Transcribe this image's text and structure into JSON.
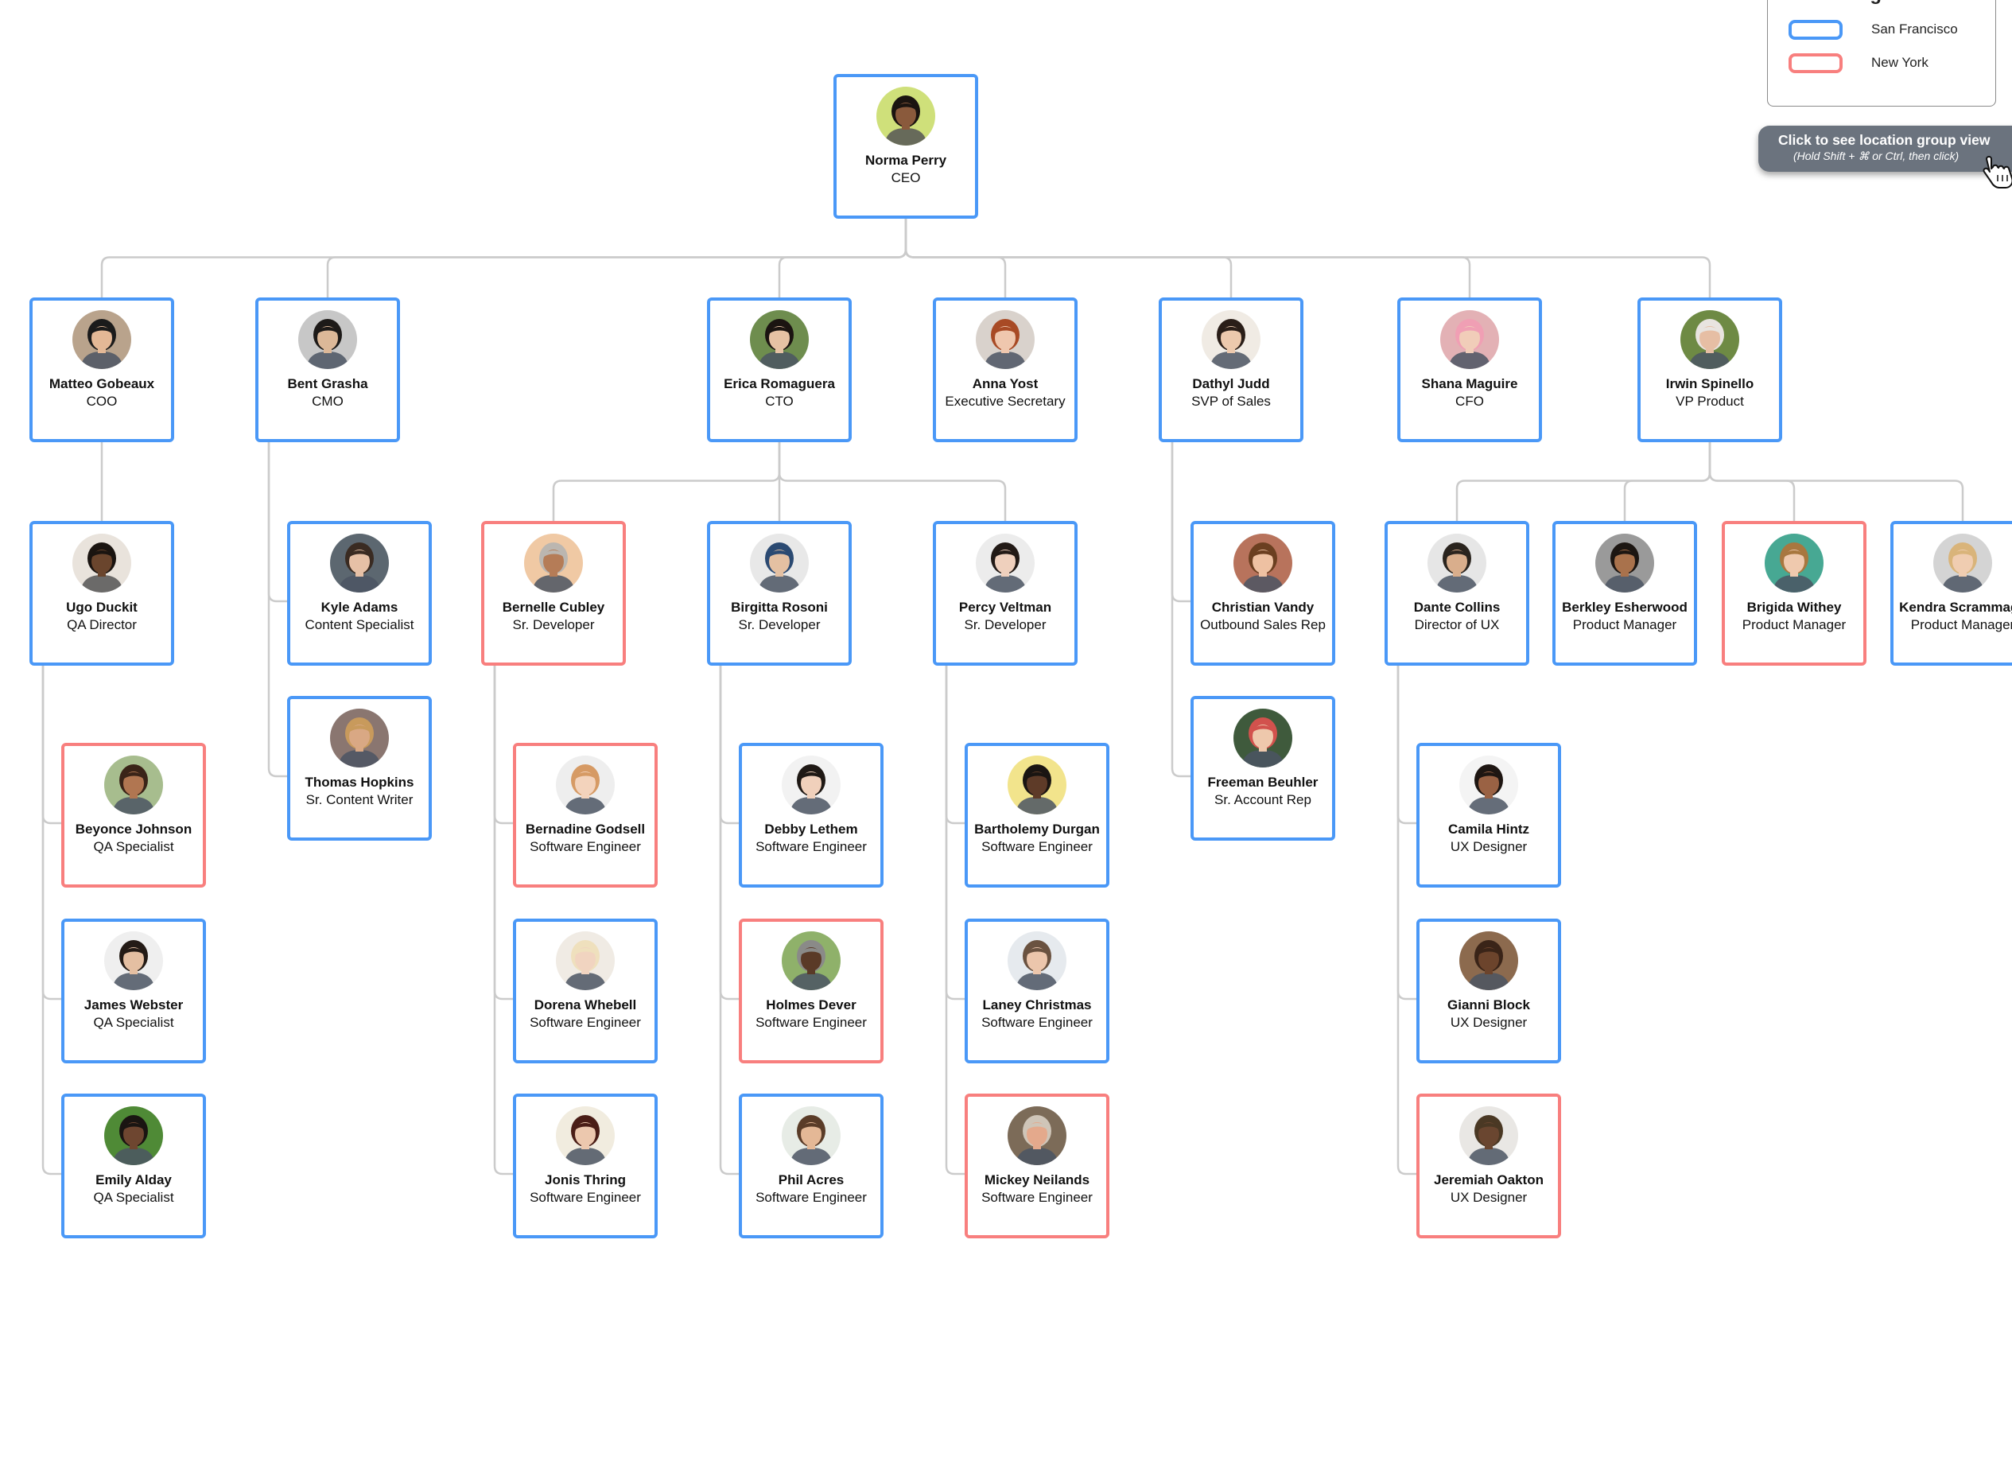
{
  "legend": {
    "title": "Legend",
    "items": [
      {
        "label": "San Francisco",
        "color": "#4a98f7"
      },
      {
        "label": "New York",
        "color": "#f87f7e"
      }
    ]
  },
  "group_view_button": {
    "label": "Click to see location group view",
    "hint": "(Hold Shift + ⌘ or Ctrl, then click)"
  },
  "locations": {
    "sf": {
      "name": "San Francisco",
      "color": "#4a98f7"
    },
    "ny": {
      "name": "New York",
      "color": "#f87f7e"
    }
  },
  "people": [
    {
      "id": "norma",
      "name": "Norma Perry",
      "title": "CEO",
      "loc": "sf",
      "parent": null,
      "skin": "#8a5a3c",
      "hair": "#1a1410",
      "bg": "#cfe07a"
    },
    {
      "id": "matteo",
      "name": "Matteo Gobeaux",
      "title": "COO",
      "loc": "sf",
      "parent": "norma",
      "skin": "#e3b896",
      "hair": "#1b1b1b",
      "bg": "#b9a38c"
    },
    {
      "id": "bent",
      "name": "Bent Grasha",
      "title": "CMO",
      "loc": "sf",
      "parent": "norma",
      "skin": "#dcb898",
      "hair": "#1d1a18",
      "bg": "#c7c7c7"
    },
    {
      "id": "erica",
      "name": "Erica Romaguera",
      "title": "CTO",
      "loc": "sf",
      "parent": "norma",
      "skin": "#e6c2a4",
      "hair": "#1b1411",
      "bg": "#6e8d4e"
    },
    {
      "id": "anna",
      "name": "Anna Yost",
      "title": "Executive Secretary",
      "loc": "sf",
      "parent": "norma",
      "skin": "#efc7ae",
      "hair": "#a84a25",
      "bg": "#d9d2cc"
    },
    {
      "id": "dathyl",
      "name": "Dathyl Judd",
      "title": "SVP of Sales",
      "loc": "sf",
      "parent": "norma",
      "skin": "#ecc9ad",
      "hair": "#2a1e18",
      "bg": "#f0ebe4"
    },
    {
      "id": "shana",
      "name": "Shana Maguire",
      "title": "CFO",
      "loc": "sf",
      "parent": "norma",
      "skin": "#f1cdb9",
      "hair": "#f09fb4",
      "bg": "#e3b1b5"
    },
    {
      "id": "irwin",
      "name": "Irwin Spinello",
      "title": "VP Product",
      "loc": "sf",
      "parent": "norma",
      "skin": "#e6bea4",
      "hair": "#e8e4e0",
      "bg": "#6e8a44"
    },
    {
      "id": "ugo",
      "name": "Ugo Duckit",
      "title": "QA Director",
      "loc": "sf",
      "parent": "matteo",
      "skin": "#6a452d",
      "hair": "#1a1410",
      "bg": "#e9e3dc"
    },
    {
      "id": "kyle",
      "name": "Kyle Adams",
      "title": "Content Specialist",
      "loc": "sf",
      "parent": "bent",
      "skin": "#e6c0a6",
      "hair": "#3a2b22",
      "bg": "#5c6770"
    },
    {
      "id": "thomas",
      "name": "Thomas Hopkins",
      "title": "Sr. Content Writer",
      "loc": "sf",
      "parent": "bent",
      "skin": "#d9a884",
      "hair": "#c89a5c",
      "bg": "#8a7670"
    },
    {
      "id": "bernelle",
      "name": "Bernelle Cubley",
      "title": "Sr. Developer",
      "loc": "ny",
      "parent": "erica",
      "skin": "#b57c57",
      "hair": "#bbb6b0",
      "bg": "#f0c9a4"
    },
    {
      "id": "birgitta",
      "name": "Birgitta Rosoni",
      "title": "Sr. Developer",
      "loc": "sf",
      "parent": "erica",
      "skin": "#e4c0a2",
      "hair": "#2b4a72",
      "bg": "#e8e8e8"
    },
    {
      "id": "percy",
      "name": "Percy Veltman",
      "title": "Sr. Developer",
      "loc": "sf",
      "parent": "erica",
      "skin": "#efd0bd",
      "hair": "#221a16",
      "bg": "#ececec"
    },
    {
      "id": "christian",
      "name": "Christian Vandy",
      "title": "Outbound Sales Rep",
      "loc": "sf",
      "parent": "dathyl",
      "skin": "#eec1a2",
      "hair": "#6b3f20",
      "bg": "#b8735c"
    },
    {
      "id": "freeman",
      "name": "Freeman Beuhler",
      "title": "Sr. Account Rep",
      "loc": "sf",
      "parent": "dathyl",
      "skin": "#eec8ac",
      "hair": "#d2524d",
      "bg": "#3f5a3c"
    },
    {
      "id": "dante",
      "name": "Dante Collins",
      "title": "Director of UX",
      "loc": "sf",
      "parent": "irwin",
      "skin": "#d9ae8c",
      "hair": "#2a241e",
      "bg": "#e6e6e6"
    },
    {
      "id": "berkley",
      "name": "Berkley Esherwood",
      "title": "Product Manager",
      "loc": "sf",
      "parent": "irwin",
      "skin": "#a9724c",
      "hair": "#1c1612",
      "bg": "#9a9a9a"
    },
    {
      "id": "brigida",
      "name": "Brigida Withey",
      "title": "Product Manager",
      "loc": "ny",
      "parent": "irwin",
      "skin": "#efc9ae",
      "hair": "#a8773f",
      "bg": "#47a893"
    },
    {
      "id": "kendra",
      "name": "Kendra Scrammage",
      "title": "Product Manager",
      "loc": "sf",
      "parent": "irwin",
      "skin": "#f0cdb1",
      "hair": "#d9b47a",
      "bg": "#d4d4d4"
    },
    {
      "id": "beyonce",
      "name": "Beyonce Johnson",
      "title": "QA Specialist",
      "loc": "ny",
      "parent": "ugo",
      "skin": "#b17651",
      "hair": "#3a2418",
      "bg": "#a7bd8e"
    },
    {
      "id": "james",
      "name": "James Webster",
      "title": "QA Specialist",
      "loc": "sf",
      "parent": "ugo",
      "skin": "#e4bfa2",
      "hair": "#241b16",
      "bg": "#efefef"
    },
    {
      "id": "emily",
      "name": "Emily Alday",
      "title": "QA Specialist",
      "loc": "sf",
      "parent": "ugo",
      "skin": "#6e4630",
      "hair": "#1a1512",
      "bg": "#4f8a36"
    },
    {
      "id": "bernadine",
      "name": "Bernadine Godsell",
      "title": "Software Engineer",
      "loc": "ny",
      "parent": "bernelle",
      "skin": "#f3d3bc",
      "hair": "#d69a64",
      "bg": "#eeeeee"
    },
    {
      "id": "dorena",
      "name": "Dorena Whebell",
      "title": "Software Engineer",
      "loc": "sf",
      "parent": "bernelle",
      "skin": "#f1d4c0",
      "hair": "#efe0bd",
      "bg": "#f0ebe4"
    },
    {
      "id": "jonis",
      "name": "Jonis Thring",
      "title": "Software Engineer",
      "loc": "sf",
      "parent": "bernelle",
      "skin": "#ecc8ae",
      "hair": "#4a1d16",
      "bg": "#f1ecdf"
    },
    {
      "id": "debby",
      "name": "Debby Lethem",
      "title": "Software Engineer",
      "loc": "sf",
      "parent": "birgitta",
      "skin": "#f0d0bb",
      "hair": "#1f1915",
      "bg": "#f2f2f2"
    },
    {
      "id": "holmes",
      "name": "Holmes Dever",
      "title": "Software Engineer",
      "loc": "ny",
      "parent": "birgitta",
      "skin": "#5a3a27",
      "hair": "#8a8a88",
      "bg": "#8fb16a"
    },
    {
      "id": "phil",
      "name": "Phil Acres",
      "title": "Software Engineer",
      "loc": "sf",
      "parent": "birgitta",
      "skin": "#e4b896",
      "hair": "#5a3c28",
      "bg": "#e7ece6"
    },
    {
      "id": "bartholemy",
      "name": "Bartholemy Durgan",
      "title": "Software Engineer",
      "loc": "sf",
      "parent": "percy",
      "skin": "#5e3b28",
      "hair": "#1a1512",
      "bg": "#f2e48c"
    },
    {
      "id": "laney",
      "name": "Laney Christmas",
      "title": "Software Engineer",
      "loc": "sf",
      "parent": "percy",
      "skin": "#ecc6ac",
      "hair": "#6a5240",
      "bg": "#e6eaee"
    },
    {
      "id": "mickey",
      "name": "Mickey Neilands",
      "title": "Software Engineer",
      "loc": "ny",
      "parent": "percy",
      "skin": "#e4a98c",
      "hair": "#cfc5b8",
      "bg": "#7c6b58"
    },
    {
      "id": "camila",
      "name": "Camila Hintz",
      "title": "UX Designer",
      "loc": "sf",
      "parent": "dante",
      "skin": "#9a6244",
      "hair": "#1e1612",
      "bg": "#f4f4f4"
    },
    {
      "id": "gianni",
      "name": "Gianni Block",
      "title": "UX Designer",
      "loc": "sf",
      "parent": "dante",
      "skin": "#6c442c",
      "hair": "#3a2418",
      "bg": "#8c6a4e"
    },
    {
      "id": "jeremiah",
      "name": "Jeremiah Oakton",
      "title": "UX Designer",
      "loc": "ny",
      "parent": "dante",
      "skin": "#6a4630",
      "hair": "#4a3824",
      "bg": "#e9e7e4"
    }
  ]
}
